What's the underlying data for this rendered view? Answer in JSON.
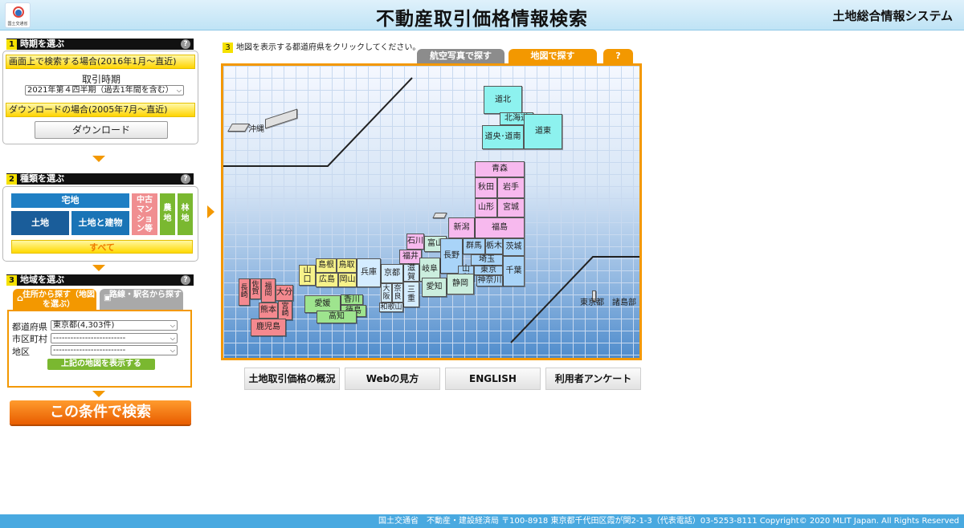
{
  "header": {
    "title": "不動産取引価格情報検索",
    "system_name": "土地総合情報システム",
    "logo_text": "国土交通省"
  },
  "step1": {
    "num": "1",
    "title": "時期を選ぶ",
    "help": "?",
    "screen_search_label": "画面上で検索する場合(2016年1月〜直近)",
    "period_label": "取引時期",
    "period_value": "2021年第４四半期（過去1年間を含む）",
    "download_label": "ダウンロードの場合(2005年7月〜直近)",
    "download_button": "ダウンロード"
  },
  "step2": {
    "num": "2",
    "title": "種類を選ぶ",
    "help": "?",
    "takuchi": "宅地",
    "tochi": "土地",
    "tochi_tatemono": "土地と建物",
    "mansion": "中古マンション等",
    "nouchi": "農地",
    "rinchi": "林地",
    "all": "すべて"
  },
  "step3": {
    "num": "3",
    "title": "地域を選ぶ",
    "help": "?",
    "tab_address": "住所から探す（地図を選ぶ）",
    "tab_route": "路線・駅名から探す",
    "pref_label": "都道府県",
    "pref_value": "東京都(4,303件)",
    "city_label": "市区町村",
    "city_value": "-------------------------",
    "district_label": "地区",
    "district_value": "-------------------------",
    "show_map_button": "上記の地図を表示する"
  },
  "search_button": "この条件で検索",
  "map_panel": {
    "num": "3",
    "instruction": "地図を表示する都道府県をクリックしてください。",
    "tab_aerial": "航空写真で探す",
    "tab_map": "地図で探す",
    "tab_help": "?"
  },
  "map_labels": {
    "okinawa": "沖縄",
    "tokyo_islands": "東京都　諸島部"
  },
  "prefs": {
    "dohoku": "道北",
    "hokkaido": "北海道",
    "donan": "道央･道南",
    "doto": "道東",
    "aomori": "青森",
    "akita": "秋田",
    "iwate": "岩手",
    "yamagata": "山形",
    "miyagi": "宮城",
    "fukushima": "福島",
    "niigata": "新潟",
    "ishikawa": "石川",
    "toyama": "富山",
    "fukui": "福井",
    "gunma": "群馬",
    "tochigi": "栃木",
    "ibaraki": "茨城",
    "saitama": "埼玉",
    "nagano": "長野",
    "gifu": "岐阜",
    "yamanashi": "山梨",
    "tokyo": "東京",
    "chiba": "千葉",
    "kanagawa": "神奈川",
    "shizuoka": "静岡",
    "aichi": "愛知",
    "shiga": "滋賀",
    "kyoto": "京都",
    "hyogo": "兵庫",
    "osaka": "大阪",
    "nara": "奈良",
    "mie": "三重",
    "wakayama": "和歌山",
    "tottori": "鳥取",
    "shimane": "島根",
    "okayama": "岡山",
    "hiroshima": "広島",
    "yamaguchi": "山口",
    "kagawa": "香川",
    "tokushima": "徳島",
    "ehime": "愛媛",
    "kochi": "高知",
    "fukuoka": "福岡",
    "saga": "佐賀",
    "nagasaki": "長崎",
    "oita": "大分",
    "kumamoto": "熊本",
    "miyazaki": "宮崎",
    "kagoshima": "鹿児島"
  },
  "bottom_links": [
    "土地取引価格の概況",
    "Webの見方",
    "ENGLISH",
    "利用者アンケート"
  ],
  "footer": "国土交通省　不動産・建設経済局 〒100-8918 東京都千代田区霞が関2-1-3（代表電話）03-5253-8111 Copyright© 2020 MLIT Japan. All Rights Reserved",
  "colors": {
    "accent_orange": "#f39800",
    "brand_blue": "#1a6fae",
    "footer_blue": "#49a9e0"
  }
}
